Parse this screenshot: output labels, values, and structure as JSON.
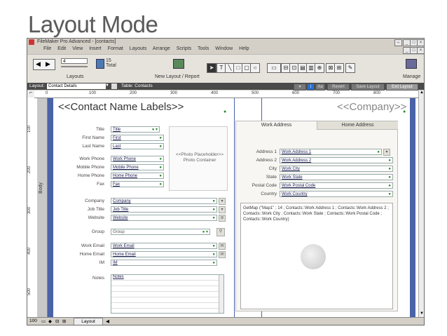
{
  "slide_title": "Layout Mode",
  "window": {
    "title": "FileMaker Pro Advanced - [contacts]",
    "menu": [
      "File",
      "Edit",
      "View",
      "Insert",
      "Format",
      "Layouts",
      "Arrange",
      "Scripts",
      "Tools",
      "Window",
      "Help"
    ]
  },
  "toolbar": {
    "layout_number": "4",
    "total_count": "15",
    "total_label": "Total",
    "layouts_label": "Layouts",
    "new_layout_label": "New Layout / Report",
    "manage_label": "Manage"
  },
  "layout_bar": {
    "layout_label": "Layout:",
    "layout_value": "Contact Details",
    "table_label": "Table: Contacts",
    "aa_label": "Aa",
    "revert_label": "Revert",
    "save_label": "Save Layout",
    "exit_label": "Exit Layout"
  },
  "ruler": {
    "ticks": [
      "0",
      "100",
      "200",
      "300",
      "400",
      "500",
      "600",
      "700",
      "800"
    ],
    "vticks": [
      "100",
      "200",
      "300",
      "400",
      "500"
    ]
  },
  "canvas": {
    "body_part_label": "Body",
    "contact_name": "<<Contact Name Labels>>",
    "company_merge": "<<Company>>",
    "photo_placeholder": "<<Photo Placeholder>>",
    "photo_container": "Photo Container",
    "left_fields": [
      {
        "label": "Title",
        "value": "Title"
      },
      {
        "label": "First Name",
        "value": "First"
      },
      {
        "label": "Last Name",
        "value": "Last"
      },
      {
        "label": "Work Phone",
        "value": "Work Phone"
      },
      {
        "label": "Mobile Phone",
        "value": "Mobile Phone"
      },
      {
        "label": "Home Phone",
        "value": "Home Phone"
      },
      {
        "label": "Fax",
        "value": "Fax"
      },
      {
        "label": "Company",
        "value": "Company"
      },
      {
        "label": "Job Title",
        "value": "Job Title"
      },
      {
        "label": "Website",
        "value": "Website"
      },
      {
        "label": "Group",
        "value": "Group"
      },
      {
        "label": "Work Email",
        "value": "Work Email"
      },
      {
        "label": "Home Email",
        "value": "Home Email"
      },
      {
        "label": "IM",
        "value": "IM"
      },
      {
        "label": "Notes",
        "value": "Notes"
      }
    ],
    "tabs": [
      "Work Address",
      "Home Address"
    ],
    "address_fields": [
      {
        "label": "Address 1",
        "value": "Work Address 1"
      },
      {
        "label": "Address 2",
        "value": "Work Address 2"
      },
      {
        "label": "City",
        "value": "Work City"
      },
      {
        "label": "State",
        "value": "Work State"
      },
      {
        "label": "Postal Code",
        "value": "Work Postal Code"
      },
      {
        "label": "Country",
        "value": "Work Country"
      }
    ],
    "getmap_text": "GetMap (\"Map1\" ; 14 ; Contacts::Work Address 1 ; Contacts::Work Address 2 ; Contacts::Work City ; Contacts::Work State ; Contacts::Work Postal Code ; Contacts::Work Country)"
  },
  "status": {
    "zoom": "100",
    "mode": "Layout"
  },
  "colors": {
    "accent_blue": "#4a63a8",
    "field_text": "#223366",
    "magnifier_green": "#2a8a2a"
  }
}
